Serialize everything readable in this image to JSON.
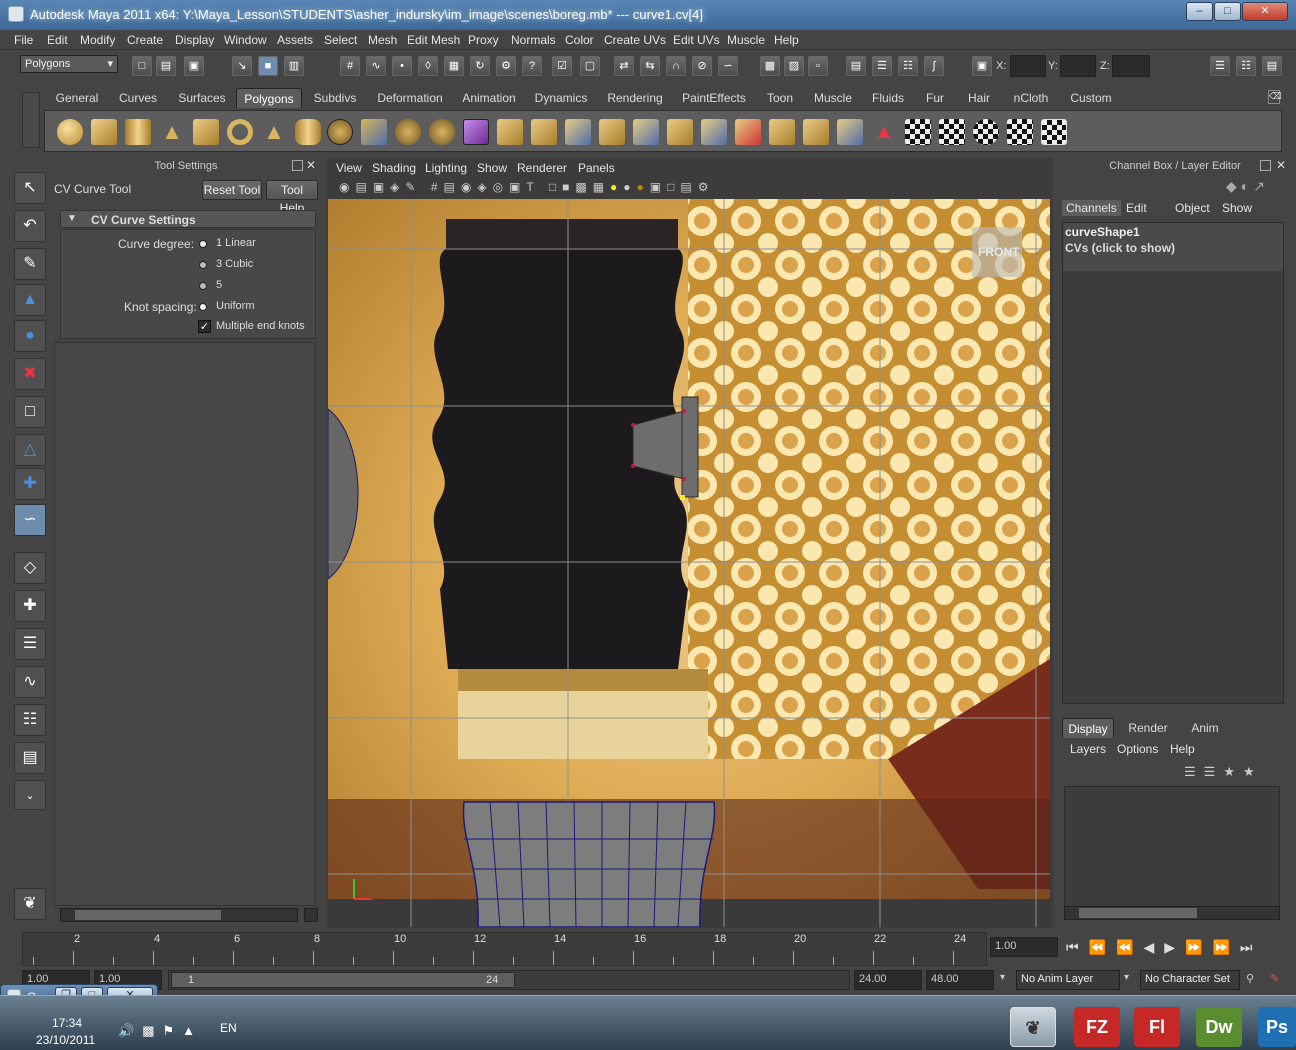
{
  "window": {
    "title": "Autodesk Maya 2011 x64: Y:\\Maya_Lesson\\STUDENTS\\asher_indursky\\im_image\\scenes\\boreg.mb*   ---   curve1.cv[4]"
  },
  "menubar": [
    "File",
    "Edit",
    "Modify",
    "Create",
    "Display",
    "Window",
    "Assets",
    "Select",
    "Mesh",
    "Edit Mesh",
    "Proxy",
    "Normals",
    "Color",
    "Create UVs",
    "Edit UVs",
    "Muscle",
    "Help"
  ],
  "statusline": {
    "mode": "Polygons",
    "x_label": "X:",
    "y_label": "Y:",
    "z_label": "Z:"
  },
  "shelf": {
    "tabs": [
      "General",
      "Curves",
      "Surfaces",
      "Polygons",
      "Subdivs",
      "Deformation",
      "Animation",
      "Dynamics",
      "Rendering",
      "PaintEffects",
      "Toon",
      "Muscle",
      "Fluids",
      "Fur",
      "Hair",
      "nCloth",
      "Custom"
    ],
    "active_tab": "Polygons"
  },
  "tool_settings": {
    "panel_title": "Tool Settings",
    "tool_name": "CV Curve Tool",
    "reset_button": "Reset Tool",
    "help_button": "Tool Help",
    "section_title": "CV Curve Settings",
    "curve_degree_label": "Curve degree:",
    "degree_options": [
      "1 Linear",
      "3 Cubic",
      "5"
    ],
    "selected_degree": "1 Linear",
    "knot_spacing_label": "Knot spacing:",
    "knot_option": "Uniform",
    "multiple_end_knots_label": "Multiple end knots",
    "multiple_end_knots_checked": true
  },
  "viewport": {
    "menus": [
      "View",
      "Shading",
      "Lighting",
      "Show",
      "Renderer",
      "Panels"
    ],
    "camera_label": "FRONT"
  },
  "channel_box": {
    "panel_title": "Channel Box / Layer Editor",
    "menus": [
      "Channels",
      "Edit",
      "Object",
      "Show"
    ],
    "object_name": "curveShape1",
    "cvs_text": "CVs (click to show)"
  },
  "layer_editor": {
    "tabs": [
      "Display",
      "Render",
      "Anim"
    ],
    "active_tab": "Display",
    "menus": [
      "Layers",
      "Options",
      "Help"
    ]
  },
  "timeline": {
    "ticks": [
      "2",
      "4",
      "6",
      "8",
      "10",
      "12",
      "14",
      "16",
      "18",
      "20",
      "22",
      "24"
    ],
    "current_time": "1.00"
  },
  "range_slider": {
    "start_time": "1.00",
    "playback_start": "1.00",
    "range_start_label": "1",
    "range_end_label": "24",
    "playback_end": "24.00",
    "end_time": "48.00",
    "anim_layer": "No Anim Layer",
    "character_set": "No Character Set"
  },
  "floating_window": {
    "title": "O..."
  },
  "taskbar": {
    "time": "17:34",
    "date": "23/10/2011",
    "language": "EN",
    "apps": [
      {
        "label": "FZ",
        "name": "filezilla",
        "color": "#c62828"
      },
      {
        "label": "Fl",
        "name": "flash",
        "color": "#c62828"
      },
      {
        "label": "Dw",
        "name": "dreamweaver",
        "color": "#5a8d2f"
      },
      {
        "label": "Ps",
        "name": "photoshop",
        "color": "#1f6fb2"
      }
    ]
  }
}
